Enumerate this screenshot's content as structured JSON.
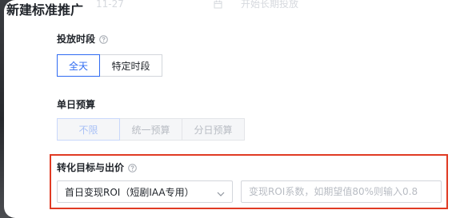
{
  "header": {
    "title": "新建标准推广"
  },
  "faded_row": {
    "date_fragment": "11-27",
    "long_term_label": "开始长期投放"
  },
  "schedule": {
    "label": "投放时段",
    "options": [
      "全天",
      "特定时段"
    ],
    "selected": "全天"
  },
  "daily_budget": {
    "label": "单日预算",
    "options": [
      "不限",
      "统一预算",
      "分日预算"
    ],
    "selected": "不限",
    "disabled": true
  },
  "conversion": {
    "label": "转化目标与出价",
    "select_value": "首日变现ROI（短剧IAA专用）",
    "roi_placeholder": "变现ROI系数，如期望值80%则输入0.8",
    "highlight_color": "#e03a23"
  },
  "colors": {
    "accent": "#2f6bf2",
    "text": "#1f2329",
    "muted": "#b8bcc3",
    "border": "#d3d6db"
  },
  "icons": {
    "help": "question-circle-icon",
    "calendar": "calendar-icon",
    "chevron": "chevron-down-icon"
  }
}
